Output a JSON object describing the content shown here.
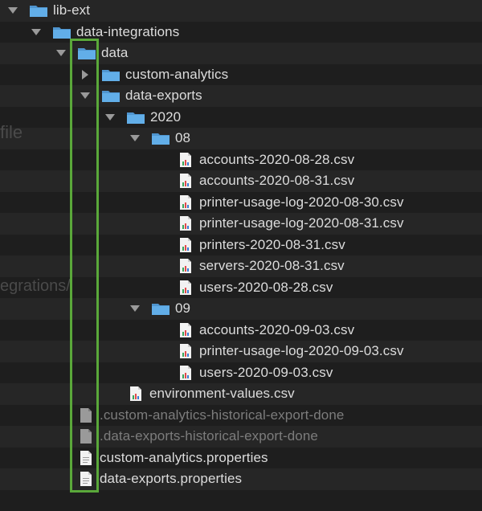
{
  "background_text": {
    "fragment_1": "file",
    "fragment_2": "egrations/"
  },
  "tree": {
    "lib_ext": {
      "label": "lib-ext",
      "icon": "folder-icon",
      "expanded": true
    },
    "data_integrations": {
      "label": "data-integrations",
      "icon": "folder-icon",
      "expanded": true
    },
    "data": {
      "label": "data",
      "icon": "folder-icon",
      "expanded": true
    },
    "custom_analytics": {
      "label": "custom-analytics",
      "icon": "folder-icon",
      "expanded": false
    },
    "data_exports": {
      "label": "data-exports",
      "icon": "folder-icon",
      "expanded": true
    },
    "y2020": {
      "label": "2020",
      "icon": "folder-icon",
      "expanded": true
    },
    "m08": {
      "label": "08",
      "icon": "folder-icon",
      "expanded": true,
      "files": [
        "accounts-2020-08-28.csv",
        "accounts-2020-08-31.csv",
        "printer-usage-log-2020-08-30.csv",
        "printer-usage-log-2020-08-31.csv",
        "printers-2020-08-31.csv",
        "servers-2020-08-31.csv",
        "users-2020-08-28.csv"
      ]
    },
    "m09": {
      "label": "09",
      "icon": "folder-icon",
      "expanded": true,
      "files": [
        "accounts-2020-09-03.csv",
        "printer-usage-log-2020-09-03.csv",
        "users-2020-09-03.csv"
      ]
    },
    "environment_values": {
      "label": "environment-values.csv",
      "icon": "csv-file-icon"
    },
    "custom_done": {
      "label": ".custom-analytics-historical-export-done",
      "icon": "generic-file-icon"
    },
    "exports_done": {
      "label": ".data-exports-historical-export-done",
      "icon": "generic-file-icon"
    },
    "custom_props": {
      "label": "custom-analytics.properties",
      "icon": "text-file-icon"
    },
    "exports_props": {
      "label": "data-exports.properties",
      "icon": "text-file-icon"
    }
  },
  "colors": {
    "background": "#1e1e1e",
    "row_alt": "#262626",
    "text": "#dcdcdc",
    "dim_text": "#7c7c7c",
    "folder": "#5aa9e6",
    "highlight": "#5aa83a"
  }
}
